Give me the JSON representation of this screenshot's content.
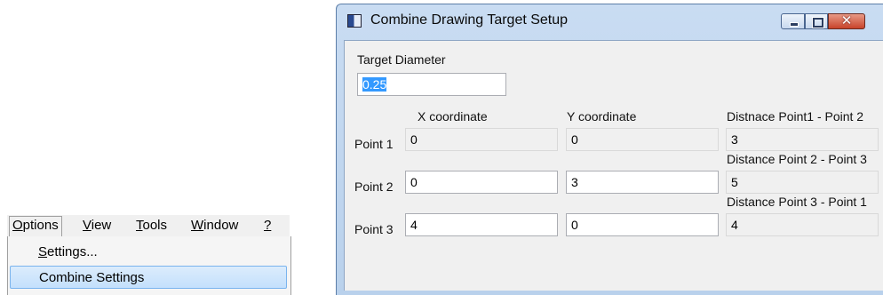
{
  "menu": {
    "bar": [
      {
        "label": "Options",
        "mnemonic": "O",
        "rest": "ptions",
        "active": true
      },
      {
        "label": "View",
        "mnemonic": "V",
        "rest": "iew"
      },
      {
        "label": "Tools",
        "mnemonic": "T",
        "rest": "ools"
      },
      {
        "label": "Window",
        "mnemonic": "W",
        "rest": "indow"
      },
      {
        "label": "?",
        "mnemonic": "?",
        "rest": ""
      }
    ],
    "dropdown": [
      {
        "label": "Settings...",
        "mnemonic": "S",
        "rest": "ettings..."
      },
      {
        "label": "Combine Settings",
        "highlighted": true
      }
    ]
  },
  "window": {
    "title": "Combine Drawing Target Setup",
    "close_glyph": "✕"
  },
  "form": {
    "diameter_label": "Target Diameter",
    "diameter_value": "0.25",
    "x_header": "X coordinate",
    "y_header": "Y coordinate",
    "points": [
      {
        "label": "Point 1",
        "x": "0",
        "y": "0",
        "x_editable": false,
        "y_editable": false
      },
      {
        "label": "Point 2",
        "x": "0",
        "y": "3",
        "x_editable": true,
        "y_editable": true
      },
      {
        "label": "Point 3",
        "x": "4",
        "y": "0",
        "x_editable": true,
        "y_editable": true
      }
    ],
    "distances": [
      {
        "label": "Distnace Point1 - Point 2",
        "value": "3"
      },
      {
        "label": "Distance Point 2 - Point 3",
        "value": "5"
      },
      {
        "label": "Distance Point 3 - Point 1",
        "value": "4"
      }
    ]
  }
}
